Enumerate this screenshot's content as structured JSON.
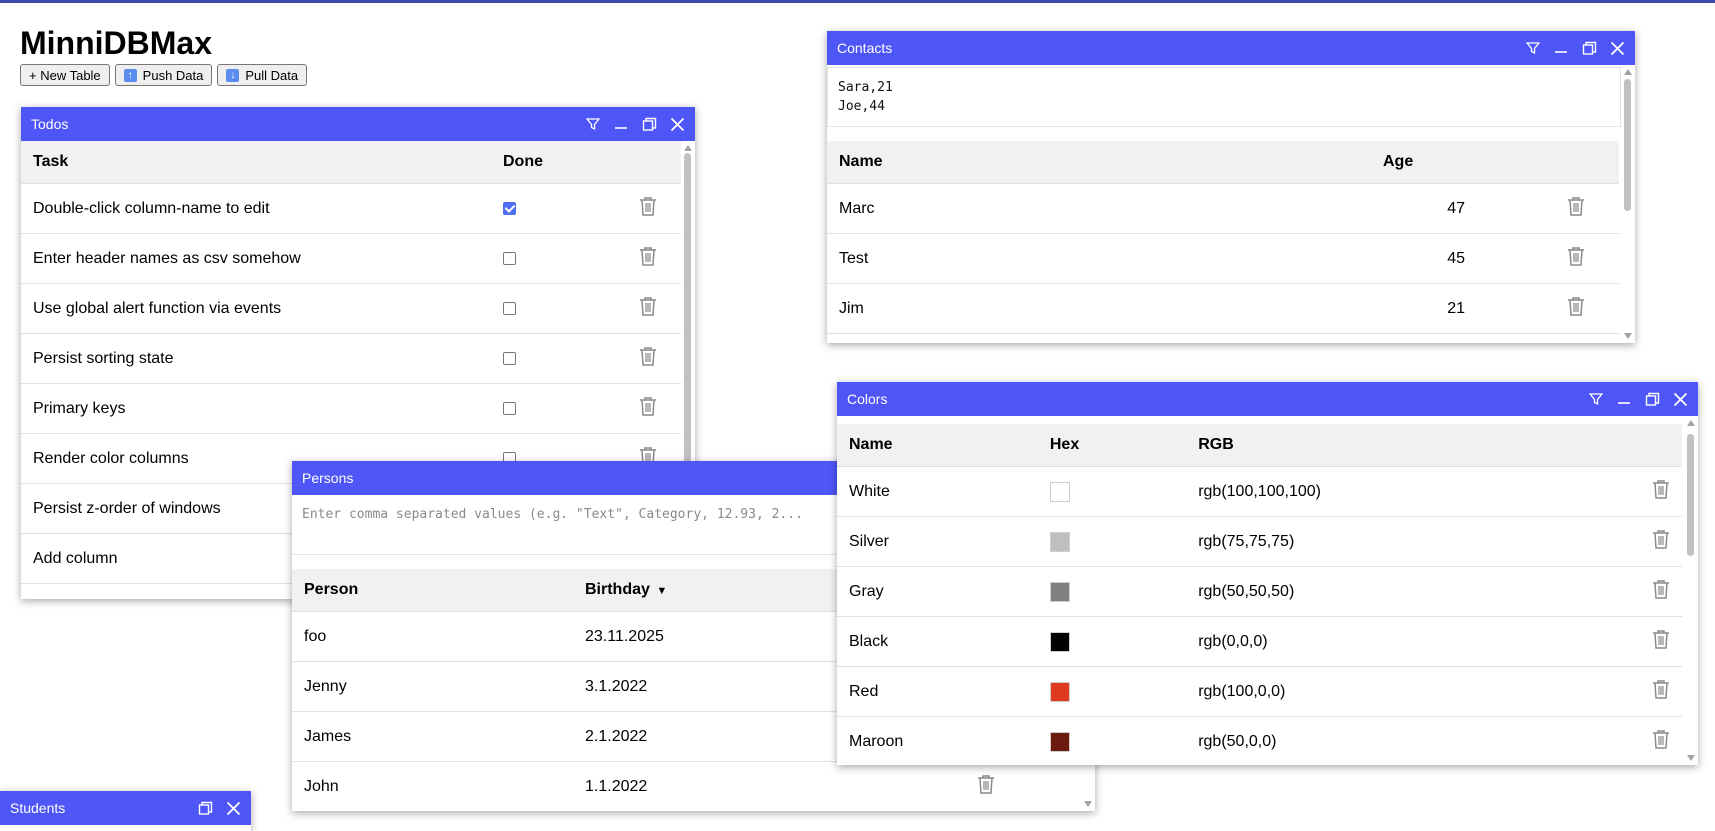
{
  "app": {
    "title": "MinniDBMax"
  },
  "toolbar": {
    "new_table_label": "+ New Table",
    "push_data_label": "Push Data",
    "pull_data_label": "Pull Data",
    "push_icon": "arrow-up-icon",
    "pull_icon": "arrow-down-icon"
  },
  "colors": {
    "titlebar": "#4f56f7",
    "header_bg": "#f1f1f1"
  },
  "todos": {
    "title": "Todos",
    "columns": [
      "Task",
      "Done"
    ],
    "rows": [
      {
        "task": "Double-click column-name to edit",
        "done": true
      },
      {
        "task": "Enter header names as csv somehow",
        "done": false
      },
      {
        "task": "Use global alert function via events",
        "done": false
      },
      {
        "task": "Persist sorting state",
        "done": false
      },
      {
        "task": "Primary keys",
        "done": false
      },
      {
        "task": "Render color columns",
        "done": false
      },
      {
        "task": "Persist z-order of windows",
        "done": false
      },
      {
        "task": "Add column",
        "done": false
      }
    ]
  },
  "contacts": {
    "title": "Contacts",
    "csv_value": "Sara,21\nJoe,44",
    "columns": [
      "Name",
      "Age"
    ],
    "rows": [
      {
        "name": "Marc",
        "age": "47"
      },
      {
        "name": "Test",
        "age": "45"
      },
      {
        "name": "Jim",
        "age": "21"
      }
    ]
  },
  "persons": {
    "title": "Persons",
    "csv_placeholder": "Enter comma separated values (e.g. \"Text\", Category, 12.93, 2...",
    "columns": [
      "Person",
      "Birthday"
    ],
    "sort_indicator": "▼",
    "rows": [
      {
        "person": "foo",
        "birthday": "23.11.2025"
      },
      {
        "person": "Jenny",
        "birthday": "3.1.2022"
      },
      {
        "person": "James",
        "birthday": "2.1.2022"
      },
      {
        "person": "John",
        "birthday": "1.1.2022"
      }
    ]
  },
  "colors_table": {
    "title": "Colors",
    "columns": [
      "Name",
      "Hex",
      "RGB"
    ],
    "rows": [
      {
        "name": "White",
        "hex": "#ffffff",
        "rgb": "rgb(100,100,100)"
      },
      {
        "name": "Silver",
        "hex": "#bfbfbf",
        "rgb": "rgb(75,75,75)"
      },
      {
        "name": "Gray",
        "hex": "#808080",
        "rgb": "rgb(50,50,50)"
      },
      {
        "name": "Black",
        "hex": "#000000",
        "rgb": "rgb(0,0,0)"
      },
      {
        "name": "Red",
        "hex": "#e03a21",
        "rgb": "rgb(100,0,0)"
      },
      {
        "name": "Maroon",
        "hex": "#6b1a0f",
        "rgb": "rgb(50,0,0)"
      }
    ]
  },
  "students": {
    "title": "Students"
  }
}
